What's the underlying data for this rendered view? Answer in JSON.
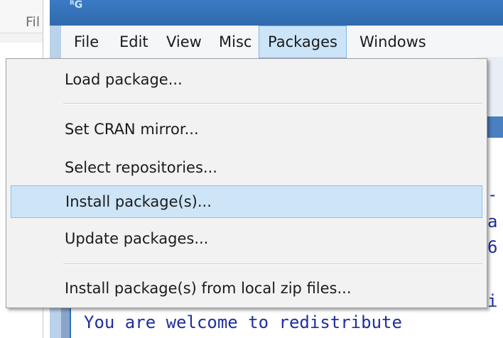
{
  "background_window": {
    "menu_label": "Fil"
  },
  "rgui": {
    "title_icon": "R-logo-icon",
    "menubar": [
      {
        "label": "File"
      },
      {
        "label": "Edit"
      },
      {
        "label": "View"
      },
      {
        "label": "Misc"
      },
      {
        "label": "Packages",
        "active": true
      },
      {
        "label": "Windows"
      }
    ]
  },
  "packages_menu": {
    "items": [
      {
        "label": "Load package..."
      },
      {
        "label": "Set CRAN mirror..."
      },
      {
        "label": "Select repositories..."
      },
      {
        "label": "Install package(s)...",
        "highlighted": true
      },
      {
        "label": "Update packages..."
      },
      {
        "label": "Install package(s) from local zip files..."
      }
    ]
  },
  "console": {
    "fragments": [
      "-",
      "a",
      "6",
      "i"
    ],
    "last_line": "You are welcome to redistribute"
  },
  "colors": {
    "highlight": "#cde5f7",
    "menu_bg": "#f2f2f2",
    "console_text": "#1f2fa0",
    "title_bar": "#2f69ad"
  }
}
